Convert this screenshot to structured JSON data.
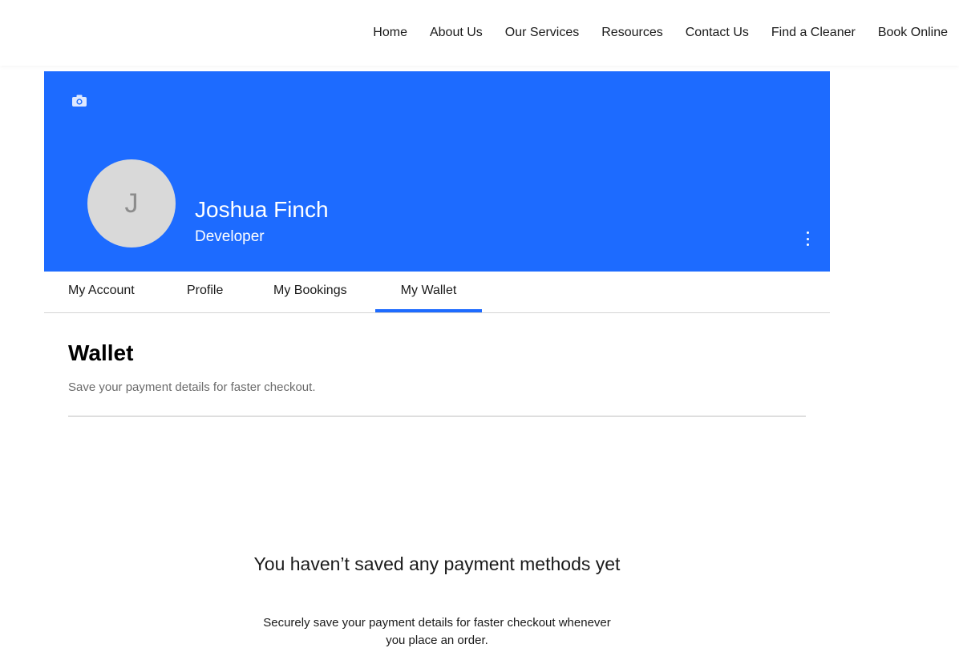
{
  "nav": {
    "items": [
      {
        "label": "Home"
      },
      {
        "label": "About Us"
      },
      {
        "label": "Our Services"
      },
      {
        "label": "Resources"
      },
      {
        "label": "Contact Us"
      },
      {
        "label": "Find a Cleaner"
      },
      {
        "label": "Book Online"
      }
    ]
  },
  "profile": {
    "avatar_initial": "J",
    "name": "Joshua Finch",
    "title": "Developer",
    "cover_color": "#1d6bff",
    "icons": {
      "cover_upload": "camera-icon",
      "more": "more-vertical-icon"
    }
  },
  "tabs": {
    "items": [
      {
        "label": "My Account"
      },
      {
        "label": "Profile"
      },
      {
        "label": "My Bookings"
      },
      {
        "label": "My Wallet"
      }
    ],
    "active": "My Wallet",
    "accent_color": "#1d6bff"
  },
  "wallet": {
    "title": "Wallet",
    "subtitle": "Save your payment details for faster checkout.",
    "empty_title": "You haven’t saved any payment methods yet",
    "empty_description": "Securely save your payment details for faster checkout whenever you place an order."
  }
}
